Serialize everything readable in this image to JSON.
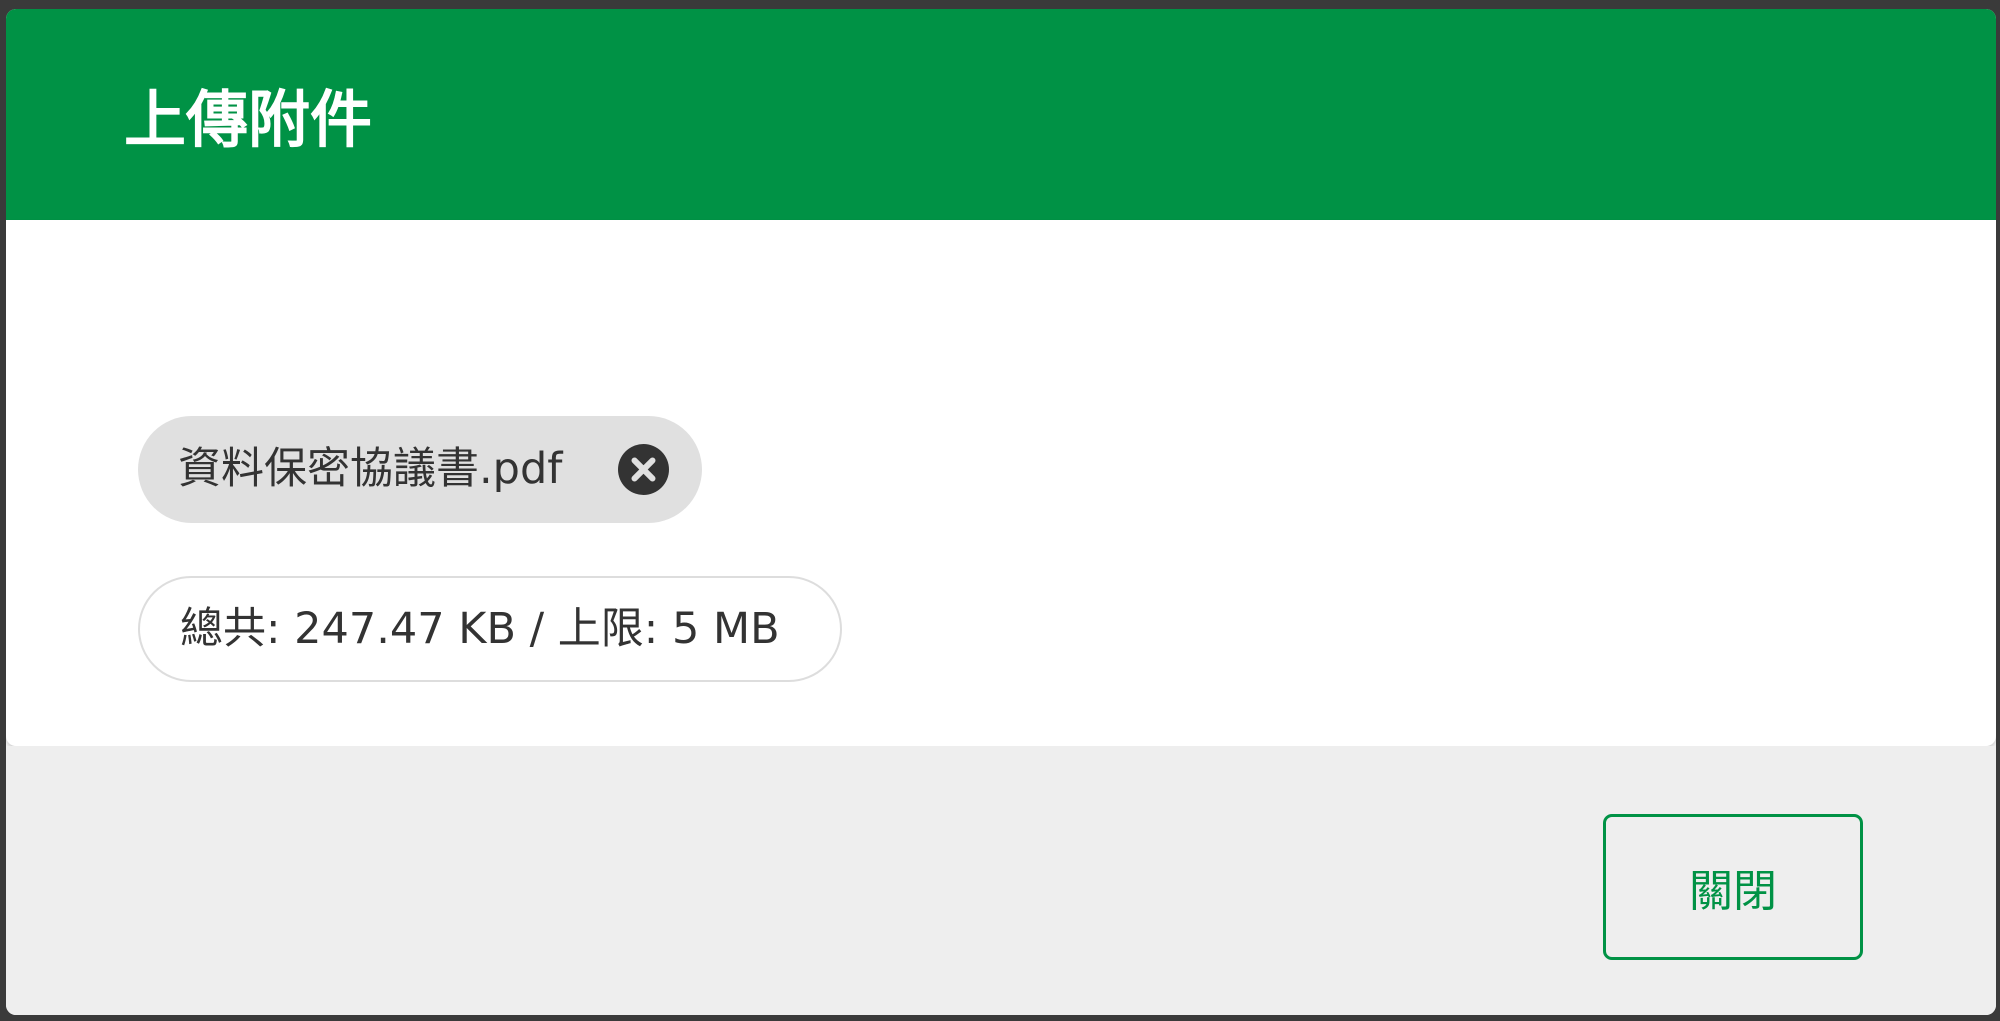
{
  "dialog": {
    "title": "上傳附件",
    "attachment": {
      "file_name": "資料保密協議書.pdf",
      "remove_icon": "close-circle-icon"
    },
    "size_summary": "總共: 247.47 KB / 上限: 5 MB",
    "close_label": "關閉"
  },
  "colors": {
    "primary": "#009245",
    "chip_bg": "#e0e0e0",
    "footer_bg": "#eeeeee",
    "text": "#333333"
  }
}
